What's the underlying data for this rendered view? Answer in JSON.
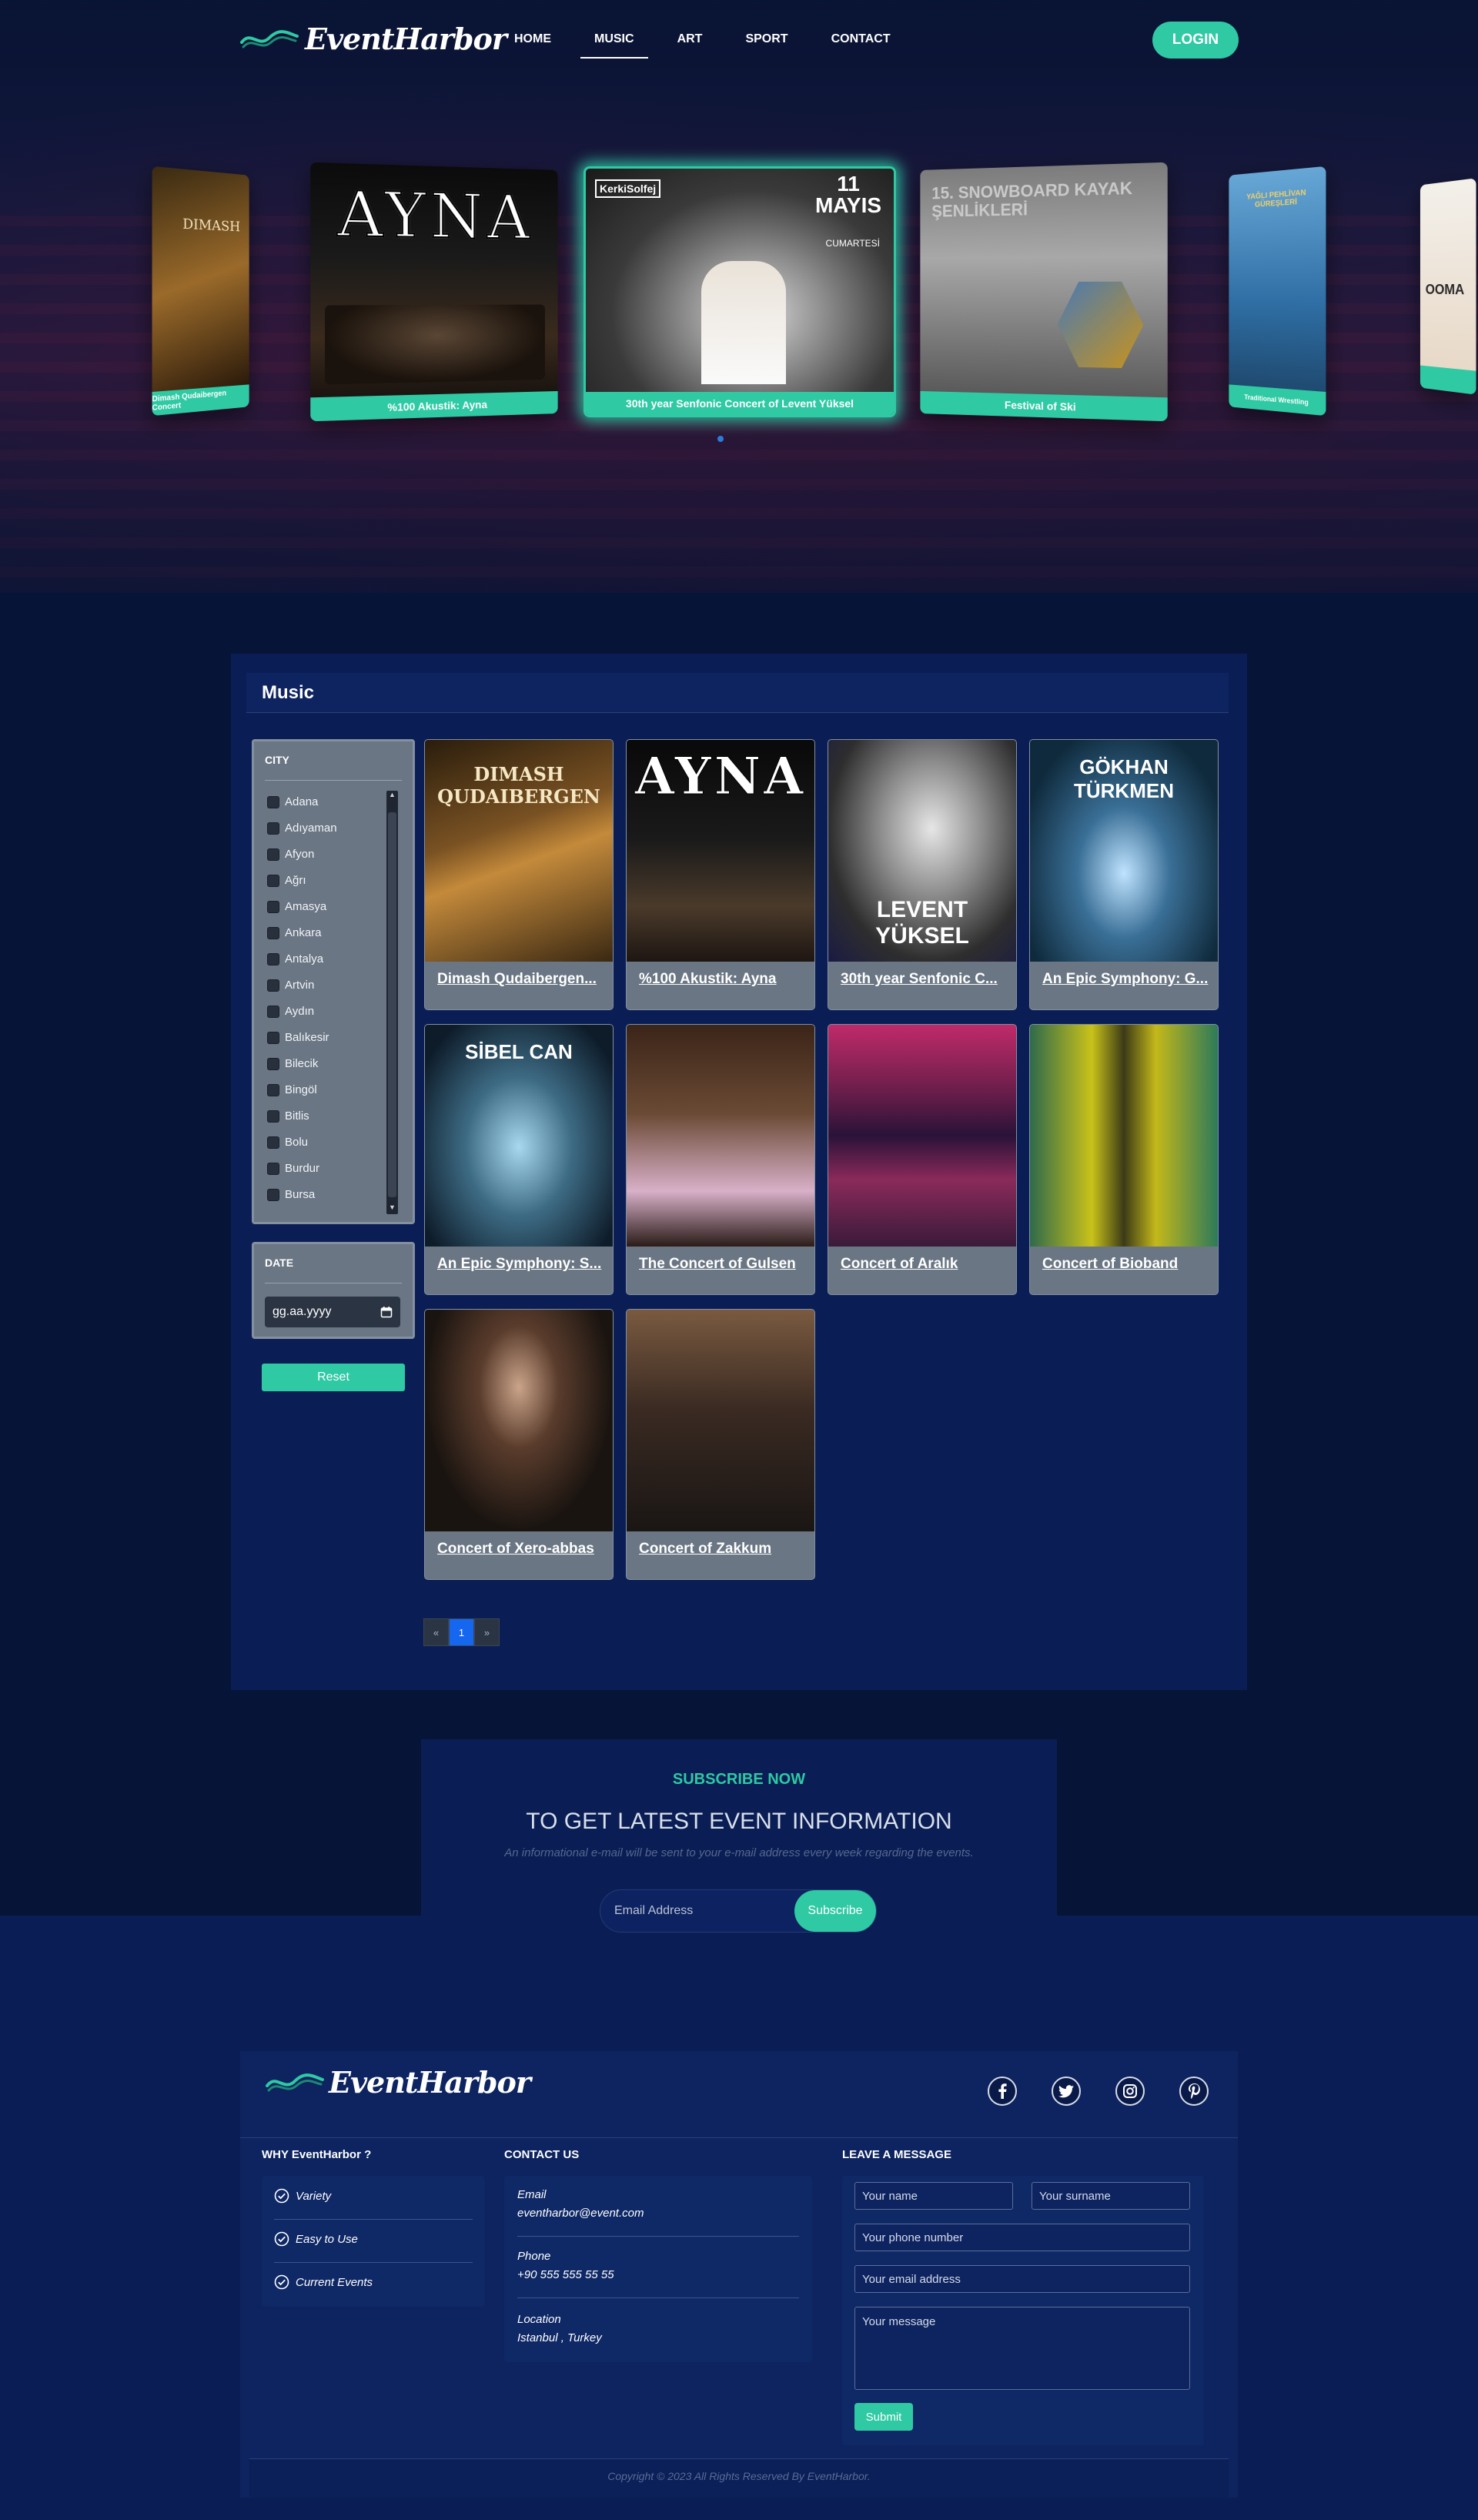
{
  "brand": {
    "name": "EventHarbor"
  },
  "nav": {
    "items": [
      {
        "label": "HOME"
      },
      {
        "label": "MUSIC"
      },
      {
        "label": "ART"
      },
      {
        "label": "SPORT"
      },
      {
        "label": "CONTACT"
      }
    ],
    "active": "MUSIC",
    "login_label": "LOGIN"
  },
  "carousel": {
    "slides": [
      {
        "caption": "Dimash Qudaibergen Concert",
        "poster_text": "DIMASH"
      },
      {
        "caption": "%100 Akustik: Ayna",
        "poster_text": "AYNA"
      },
      {
        "caption": "30th year Senfonic Concert of Levent Yüksel",
        "poster_text": "11 MAYIS",
        "poster_sub": "CUMARTESİ",
        "poster_brand": "KerkiSolfej"
      },
      {
        "caption": "Festival of Ski",
        "poster_text": "15. SNOWBOARD KAYAK ŞENLİKLERİ"
      },
      {
        "caption": "Traditional Wrestling",
        "poster_text": "YAĞLI PEHLİVAN GÜREŞLERİ"
      },
      {
        "caption": "",
        "poster_text": "OOMA"
      }
    ]
  },
  "music_section": {
    "title": "Music",
    "city_filter": {
      "title": "CITY",
      "cities": [
        "Adana",
        "Adıyaman",
        "Afyon",
        "Ağrı",
        "Amasya",
        "Ankara",
        "Antalya",
        "Artvin",
        "Aydın",
        "Balıkesir",
        "Bilecik",
        "Bingöl",
        "Bitlis",
        "Bolu",
        "Burdur",
        "Bursa"
      ]
    },
    "date_filter": {
      "title": "DATE",
      "placeholder": "gg.aa.yyyy"
    },
    "reset_label": "Reset",
    "events": [
      {
        "title": "Dimash Qudaibergen...",
        "poster": "DIMASH QUDAIBERGEN"
      },
      {
        "title": "%100 Akustik: Ayna",
        "poster": "AYNA"
      },
      {
        "title": "30th year Senfonic C...",
        "poster": "LEVENT YÜKSEL"
      },
      {
        "title": "An Epic Symphony: G...",
        "poster": "GÖKHAN TÜRKMEN"
      },
      {
        "title": "An Epic Symphony: S...",
        "poster": "SİBEL CAN"
      },
      {
        "title": "The Concert of Gulsen",
        "poster": ""
      },
      {
        "title": "Concert of Aralık",
        "poster": ""
      },
      {
        "title": "Concert of Bioband",
        "poster": ""
      },
      {
        "title": "Concert of Xero-abbas",
        "poster": ""
      },
      {
        "title": "Concert of Zakkum",
        "poster": ""
      }
    ],
    "pagination": {
      "prev": "«",
      "current": "1",
      "next": "»"
    }
  },
  "subscribe": {
    "kicker": "SUBSCRIBE NOW",
    "title": "TO GET LATEST EVENT INFORMATION",
    "description": "An informational e-mail will be sent to your e-mail address every week regarding the events.",
    "email_placeholder": "Email Address",
    "button_label": "Subscribe"
  },
  "footer": {
    "why": {
      "title": "WHY EventHarbor ?",
      "items": [
        "Variety",
        "Easy to Use",
        "Current Events"
      ]
    },
    "contact": {
      "title": "CONTACT US",
      "email_label": "Email",
      "email": "eventharbor@event.com",
      "phone_label": "Phone",
      "phone": "+90 555 555 55 55",
      "location_label": "Location",
      "location": "Istanbul , Turkey"
    },
    "message": {
      "title": "LEAVE A MESSAGE",
      "name_placeholder": "Your name",
      "surname_placeholder": "Your surname",
      "phone_placeholder": "Your phone number",
      "email_placeholder": "Your email address",
      "message_placeholder": "Your message",
      "submit_label": "Submit"
    },
    "socials": [
      "facebook-icon",
      "twitter-icon",
      "instagram-icon",
      "pinterest-icon"
    ],
    "copyright": "Copyright © 2023 All Rights Reserved By EventHarbor."
  },
  "colors": {
    "accent": "#2fc9a3",
    "panel": "#0a1e55",
    "page": "#061437",
    "active_page": "#1667f0"
  }
}
